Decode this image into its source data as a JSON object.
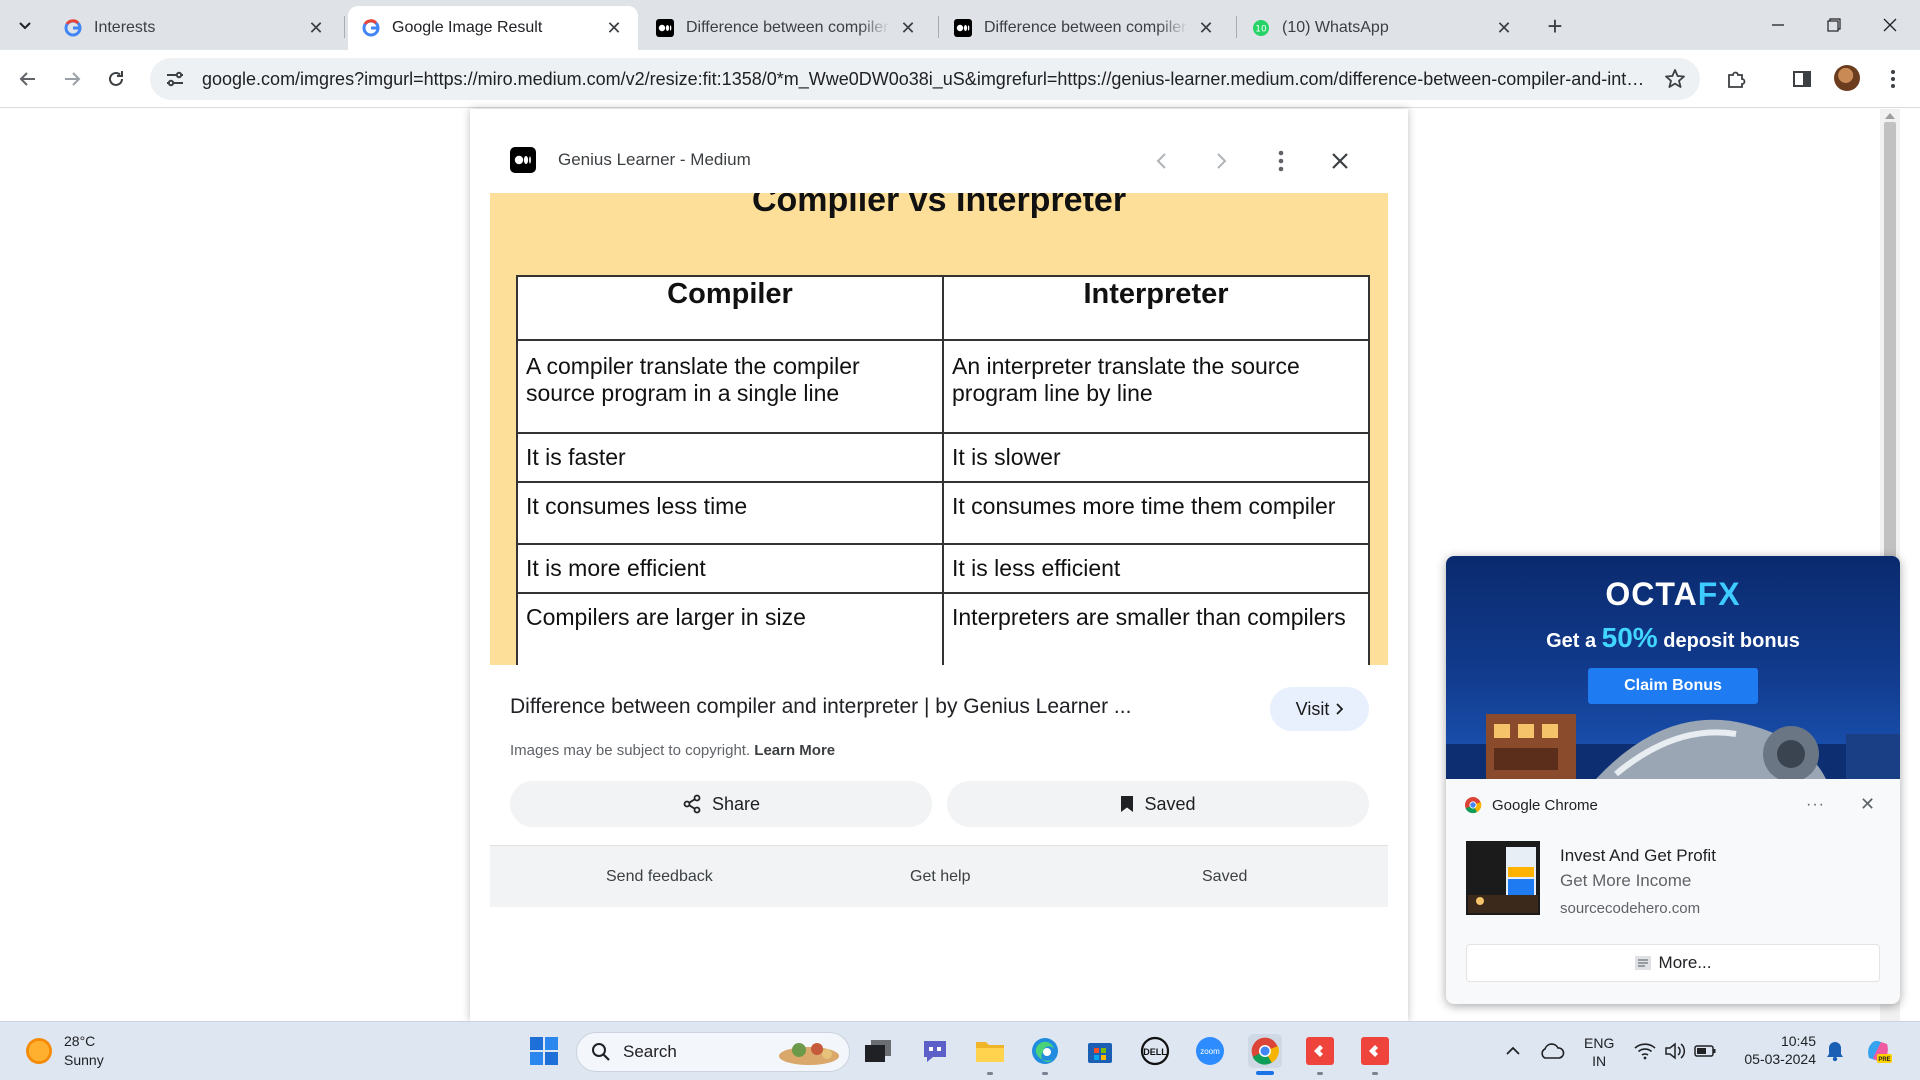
{
  "tabs": [
    {
      "title": "Interests",
      "icon": "google-g-icon"
    },
    {
      "title": "Google Image Result",
      "icon": "google-g-icon",
      "active": true
    },
    {
      "title": "Difference between compiler an",
      "icon": "medium-icon"
    },
    {
      "title": "Difference between compiler an",
      "icon": "medium-icon"
    },
    {
      "title": "(10) WhatsApp",
      "icon": "whatsapp-icon",
      "badge": "10"
    }
  ],
  "omnibox": {
    "url": "google.com/imgres?imgurl=https://miro.medium.com/v2/resize:fit:1358/0*m_Wwe0DW0o38i_uS&imgrefurl=https://genius-learner.medium.com/difference-between-compiler-and-interpr..."
  },
  "viewer": {
    "site_name": "Genius Learner - Medium",
    "image": {
      "title": "Compiler vs Interpreter",
      "headers": [
        "Compiler",
        "Interpreter"
      ],
      "rows": [
        [
          "A compiler translate the compiler source program in a single line",
          "An interpreter translate the source program line by line"
        ],
        [
          "It is faster",
          "It is slower"
        ],
        [
          "It consumes less time",
          "It consumes more time them compiler"
        ],
        [
          "It is more efficient",
          "It is less efficient"
        ],
        [
          "Compilers are larger in size",
          "Interpreters are smaller than compilers"
        ]
      ]
    },
    "caption": "Difference between compiler and interpreter | by Genius Learner ...",
    "visit_label": "Visit",
    "copyright_text": "Images may be subject to copyright.",
    "learn_more": "Learn More",
    "share_label": "Share",
    "saved_label": "Saved",
    "footer": {
      "send_feedback": "Send feedback",
      "get_help": "Get help",
      "saved": "Saved"
    }
  },
  "notification": {
    "ad": {
      "brand_a": "OCTA",
      "brand_b": "FX",
      "tag_a": "Get a",
      "tag_pct": "50%",
      "tag_b": "deposit bonus",
      "cta": "Claim Bonus"
    },
    "app_name": "Google Chrome",
    "title": "Invest And Get Profit",
    "subtitle": "Get More Income",
    "source": "sourcecodehero.com",
    "more_label": "More..."
  },
  "taskbar": {
    "temperature": "28°C",
    "condition": "Sunny",
    "search_placeholder": "Search",
    "lang_top": "ENG",
    "lang_bottom": "IN",
    "time": "10:45",
    "date": "05-03-2024"
  },
  "colors": {
    "image_background": "#fddf9a",
    "visit_button": "#e8f0fe",
    "octafx_accent": "#3ecbff",
    "claim_button": "#1e7bf2"
  }
}
